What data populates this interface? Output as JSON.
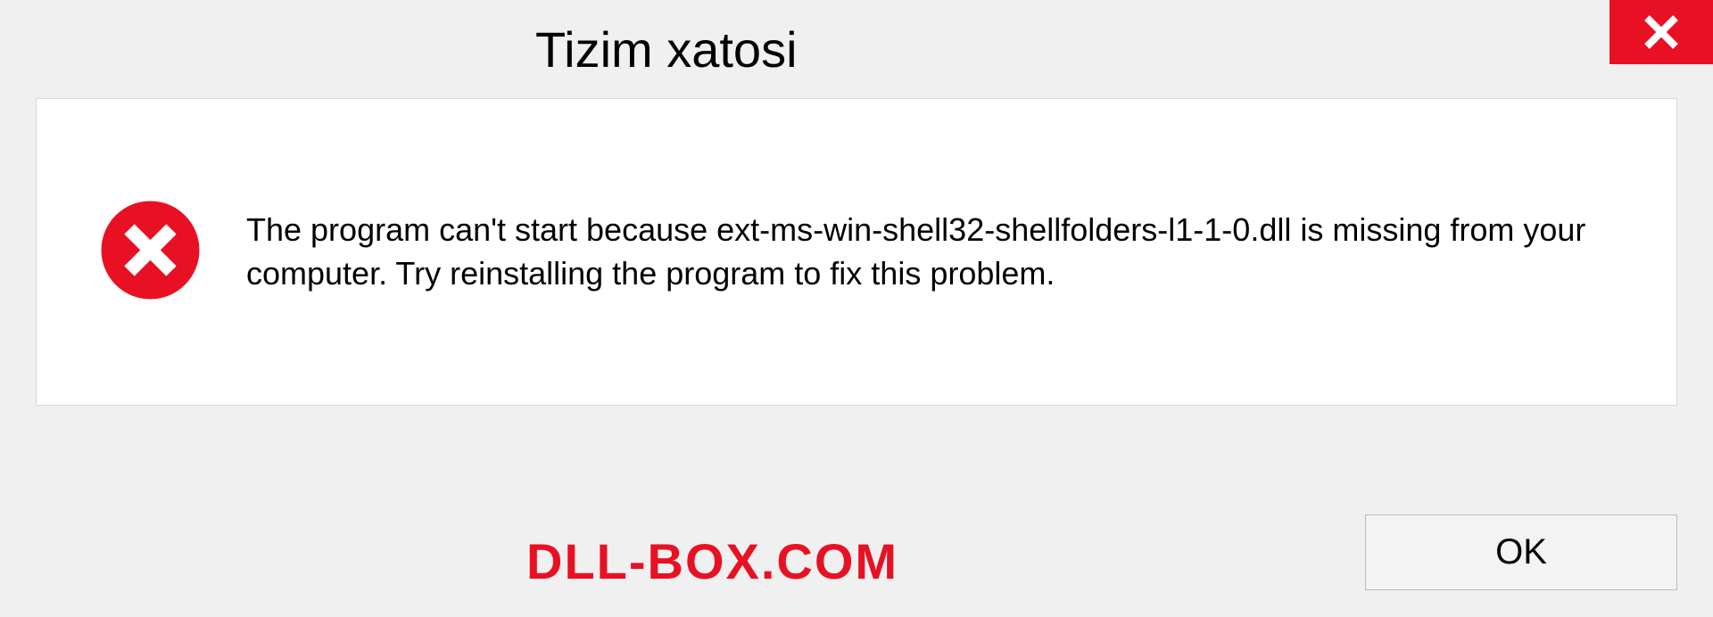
{
  "dialog": {
    "title": "Tizim xatosi",
    "message": "The program can't start because ext-ms-win-shell32-shellfolders-l1-1-0.dll is missing from your computer. Try reinstalling the program to fix this problem.",
    "ok_label": "OK"
  },
  "watermark": "DLL-BOX.COM",
  "colors": {
    "accent_red": "#e81123",
    "panel_border": "#d8d8d8",
    "button_border": "#bbbbbb"
  }
}
